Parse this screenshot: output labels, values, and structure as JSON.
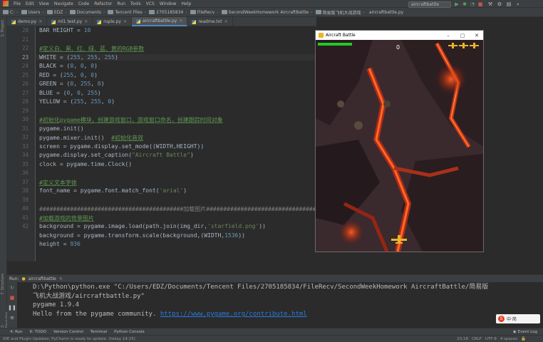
{
  "menu": [
    "File",
    "Edit",
    "View",
    "Navigate",
    "Code",
    "Refactor",
    "Run",
    "Tools",
    "VCS",
    "Window",
    "Help"
  ],
  "breadcrumb": [
    "C:",
    "Users",
    "EDZ",
    "Documents",
    "Tencent Files",
    "2705185834",
    "FileRecv",
    "SecondWeekHomework AircraftBattle",
    "简易版飞机大战游戏",
    "aircraftbattle.py"
  ],
  "run_config": "aircraftbattle",
  "tabs": [
    {
      "label": "demo.py",
      "active": false
    },
    {
      "label": "ml1 test.py",
      "active": false
    },
    {
      "label": "ruple.py",
      "active": false
    },
    {
      "label": "aircraftbattle.py",
      "active": true
    },
    {
      "label": "readme.txt",
      "active": false
    }
  ],
  "editor": {
    "line_numbers": [
      "20",
      "21",
      "22",
      "23",
      "24",
      "25",
      "26",
      "27",
      "28",
      "29",
      "30",
      "31",
      "32",
      "33",
      "34",
      "35",
      "36",
      "37",
      "38",
      "39",
      "40",
      "41",
      "42"
    ],
    "current_line": "23",
    "lines": [
      {
        "segments": [
          {
            "t": "BAR HEIGHT = ",
            "c": ""
          },
          {
            "t": "10",
            "c": "num"
          }
        ]
      },
      {
        "segments": []
      },
      {
        "segments": [
          {
            "t": "#定义白、黑、红、绿、蓝、黄的RGB参数",
            "c": "cmt"
          }
        ]
      },
      {
        "segments": [
          {
            "t": "WHITE = (",
            "c": ""
          },
          {
            "t": "255",
            "c": "num"
          },
          {
            "t": ", ",
            "c": ""
          },
          {
            "t": "255",
            "c": "num"
          },
          {
            "t": ", ",
            "c": ""
          },
          {
            "t": "255",
            "c": "num"
          },
          {
            "t": ")",
            "c": ""
          }
        ]
      },
      {
        "segments": [
          {
            "t": "BLACK = (",
            "c": ""
          },
          {
            "t": "0",
            "c": "num"
          },
          {
            "t": ", ",
            "c": ""
          },
          {
            "t": "0",
            "c": "num"
          },
          {
            "t": ", ",
            "c": ""
          },
          {
            "t": "0",
            "c": "num"
          },
          {
            "t": ")",
            "c": ""
          }
        ]
      },
      {
        "segments": [
          {
            "t": "RED = (",
            "c": ""
          },
          {
            "t": "255",
            "c": "num"
          },
          {
            "t": ", ",
            "c": ""
          },
          {
            "t": "0",
            "c": "num"
          },
          {
            "t": ", ",
            "c": ""
          },
          {
            "t": "0",
            "c": "num"
          },
          {
            "t": ")",
            "c": ""
          }
        ]
      },
      {
        "segments": [
          {
            "t": "GREEN = (",
            "c": ""
          },
          {
            "t": "0",
            "c": "num"
          },
          {
            "t": ", ",
            "c": ""
          },
          {
            "t": "255",
            "c": "num"
          },
          {
            "t": ", ",
            "c": ""
          },
          {
            "t": "0",
            "c": "num"
          },
          {
            "t": ")",
            "c": ""
          }
        ]
      },
      {
        "segments": [
          {
            "t": "BLUE = (",
            "c": ""
          },
          {
            "t": "0",
            "c": "num"
          },
          {
            "t": ", ",
            "c": ""
          },
          {
            "t": "0",
            "c": "num"
          },
          {
            "t": ", ",
            "c": ""
          },
          {
            "t": "255",
            "c": "num"
          },
          {
            "t": ")",
            "c": ""
          }
        ]
      },
      {
        "segments": [
          {
            "t": "YELLOW = (",
            "c": ""
          },
          {
            "t": "255",
            "c": "num"
          },
          {
            "t": ", ",
            "c": ""
          },
          {
            "t": "255",
            "c": "num"
          },
          {
            "t": ", ",
            "c": ""
          },
          {
            "t": "0",
            "c": "num"
          },
          {
            "t": ")",
            "c": ""
          }
        ]
      },
      {
        "segments": []
      },
      {
        "segments": [
          {
            "t": "#初始化pygame模块，创建游戏窗口，游戏窗口命名，创建跟踪时间对象",
            "c": "cmt"
          }
        ]
      },
      {
        "segments": [
          {
            "t": "pygame.init()",
            "c": ""
          }
        ]
      },
      {
        "segments": [
          {
            "t": "pygame.mixer.init()  ",
            "c": ""
          },
          {
            "t": "#初始化音效",
            "c": "cmt"
          }
        ]
      },
      {
        "segments": [
          {
            "t": "screen = pygame.display.set_mode((WIDTH,HEIGHT))",
            "c": ""
          }
        ]
      },
      {
        "segments": [
          {
            "t": "pygame.display.set_caption(",
            "c": ""
          },
          {
            "t": "\"Aircraft Battle\"",
            "c": "str"
          },
          {
            "t": ")",
            "c": ""
          }
        ]
      },
      {
        "segments": [
          {
            "t": "clock = pygame.time.Clock()",
            "c": ""
          }
        ]
      },
      {
        "segments": []
      },
      {
        "segments": [
          {
            "t": "#定义文本字体",
            "c": "cmt"
          }
        ]
      },
      {
        "segments": [
          {
            "t": "font_name = pygame.font.match_font(",
            "c": ""
          },
          {
            "t": "'arial'",
            "c": "str"
          },
          {
            "t": ")",
            "c": ""
          }
        ]
      },
      {
        "segments": []
      },
      {
        "segments": [
          {
            "t": "##########################################加载图片##########################################",
            "c": "hash"
          }
        ]
      },
      {
        "segments": [
          {
            "t": "#加载游戏的背景图片",
            "c": "cmt"
          }
        ]
      },
      {
        "segments": [
          {
            "t": "background = pygame.image.load(path.join(img_dir,",
            "c": ""
          },
          {
            "t": "'starfield.png'",
            "c": "str"
          },
          {
            "t": "))",
            "c": ""
          }
        ]
      },
      {
        "segments": [
          {
            "t": "background = pygame.transform.scale(background,(WIDTH,",
            "c": ""
          },
          {
            "t": "1536",
            "c": "num"
          },
          {
            "t": "))",
            "c": ""
          }
        ]
      },
      {
        "segments": [
          {
            "t": "height = ",
            "c": ""
          },
          {
            "t": "936",
            "c": "num"
          }
        ]
      }
    ]
  },
  "game_window": {
    "title": "Aircraft Battle",
    "score": "0",
    "health_fraction": 1.0,
    "lives": 3
  },
  "run_panel": {
    "tab_label": "aircraftbattle",
    "console": [
      "D:\\Python\\python.exe \"C:/Users/EDZ/Documents/Tencent Files/2705185834/FileRecv/SecondWeekHomework AircraftBattle/简易版",
      "飞机大战游戏/aircraftbattle.py\"",
      "pygame 1.9.4",
      "Hello from the pygame community. "
    ],
    "console_link": "https://www.pygame.org/contribute.html"
  },
  "tool_windows": [
    "4: Run",
    "6: TODO",
    "Version Control",
    "Terminal",
    "Python Console"
  ],
  "event_log": "Event Log",
  "status": {
    "message": "IDE and Plugin Updates: PyCharm is ready to update. (today 14:25)",
    "position": "23:18",
    "line_sep": "CRLF",
    "encoding": "UTF-8",
    "indent": "4 spaces"
  },
  "ime": {
    "label": "中·简"
  },
  "colors": {
    "editor_bg": "#2b2b2b",
    "panel_bg": "#3c3f41",
    "accent": "#4a88c7",
    "health": "#21c928",
    "link": "#287bde"
  }
}
